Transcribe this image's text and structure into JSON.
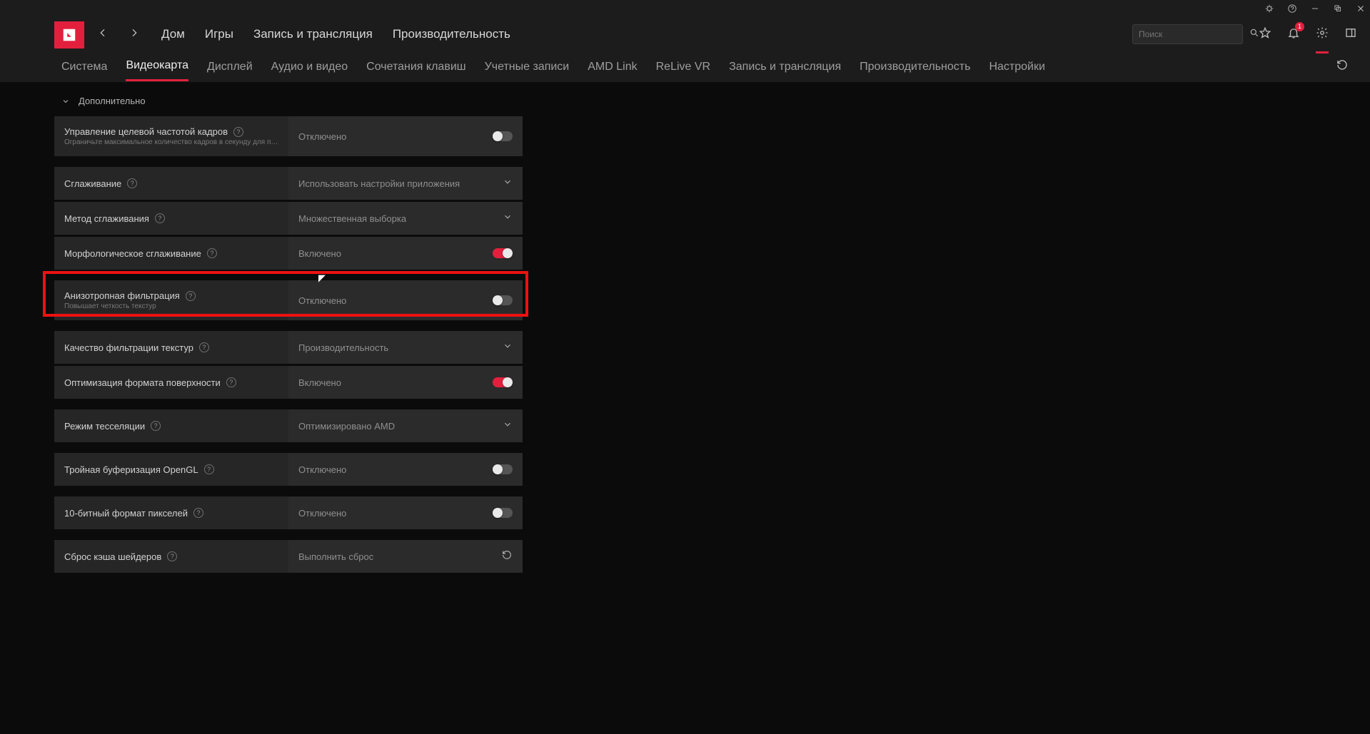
{
  "titlebar": {
    "bell_badge": ""
  },
  "search": {
    "placeholder": "Поиск"
  },
  "topnav": {
    "home": "Дом",
    "games": "Игры",
    "record": "Запись и трансляция",
    "perf": "Производительность"
  },
  "subtabs": {
    "system": "Система",
    "gpu": "Видеокарта",
    "display": "Дисплей",
    "av": "Аудио и видео",
    "hotkeys": "Сочетания клавиш",
    "accounts": "Учетные записи",
    "link": "AMD Link",
    "relive": "ReLive VR",
    "record": "Запись и трансляция",
    "perf": "Производительность",
    "settings": "Настройки"
  },
  "section": {
    "advanced": "Дополнительно"
  },
  "rows": {
    "frtc": {
      "label": "Управление целевой частотой кадров",
      "desc": "Ограничьте максимальное количество кадров в секунду для постоя...",
      "value": "Отключено",
      "on": false
    },
    "aa": {
      "label": "Сглаживание",
      "value": "Использовать настройки приложения"
    },
    "aamethod": {
      "label": "Метод сглаживания",
      "value": "Множественная выборка"
    },
    "morph": {
      "label": "Морфологическое сглаживание",
      "value": "Включено",
      "on": true
    },
    "aniso": {
      "label": "Анизотропная фильтрация",
      "desc": "Повышает четкость текстур",
      "value": "Отключено",
      "on": false
    },
    "texq": {
      "label": "Качество фильтрации текстур",
      "value": "Производительность"
    },
    "surf": {
      "label": "Оптимизация формата поверхности",
      "value": "Включено",
      "on": true
    },
    "tess": {
      "label": "Режим тесселяции",
      "value": "Оптимизировано AMD"
    },
    "triple": {
      "label": "Тройная буферизация OpenGL",
      "value": "Отключено",
      "on": false
    },
    "tenbit": {
      "label": "10-битный формат пикселей",
      "value": "Отключено",
      "on": false
    },
    "shader": {
      "label": "Сброс кэша шейдеров",
      "value": "Выполнить сброс"
    }
  },
  "bell_count": "1",
  "help": "?"
}
